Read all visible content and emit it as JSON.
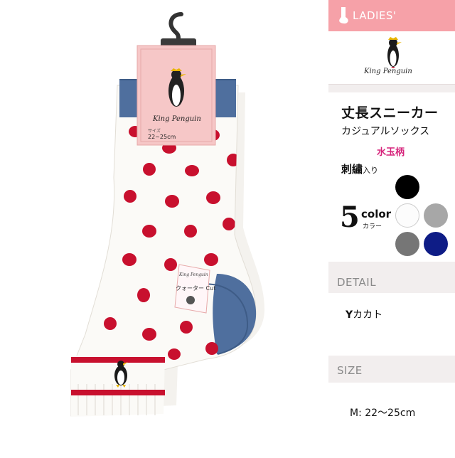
{
  "header": {
    "label": "LADIES'"
  },
  "brand": {
    "logo_text": "King Penguin",
    "tag_size": "22~25cm",
    "tag_size_label": "サイズ"
  },
  "feature": {
    "line1": "丈長スニーカー",
    "line2": "カジュアルソックス",
    "pattern": "水玉柄",
    "embroidery": "刺繍",
    "embroidery_suffix": "入り",
    "color_count": "5",
    "color_word": "color",
    "color_kana": "カラー"
  },
  "swatches": [
    {
      "name": "black",
      "hex": "#000000"
    },
    {
      "name": "white",
      "hex": "#fcfcfc"
    },
    {
      "name": "gray",
      "hex": "#a7a7a7"
    },
    {
      "name": "dark-gray",
      "hex": "#767676"
    },
    {
      "name": "navy",
      "hex": "#0e1c86"
    }
  ],
  "detail": {
    "title": "DETAIL",
    "value_strong": "Y",
    "value_rest": "カカト"
  },
  "size": {
    "title": "SIZE",
    "value": "M: 22〜25cm"
  },
  "product_tag": {
    "label": "クォーター Cut"
  },
  "colors": {
    "accent": "#f6a1a8",
    "dots": "#c8102e",
    "cuff_blue": "#4f6f9e",
    "panel_bg": "#f2eeee"
  }
}
